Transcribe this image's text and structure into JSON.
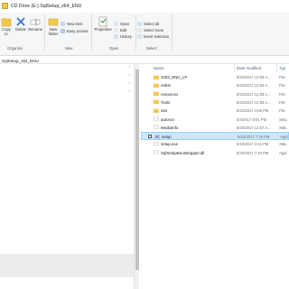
{
  "window": {
    "title": "CD Drive (E:) SqlSetup_x64_ENU"
  },
  "ribbon": {
    "copy_label": "Copy",
    "to_label": "to",
    "delete_label": "Delete",
    "rename_label": "Rename",
    "new_folder_label": "New",
    "new_folder_label2": "folder",
    "new_item_label": "New item",
    "easy_access_label": "Easy access",
    "properties_label": "Properties",
    "open_label": "Open",
    "edit_label": "Edit",
    "history_label": "History",
    "select_all_label": "Select all",
    "select_none_label": "Select none",
    "invert_selection_label": "Invert selection",
    "groups": {
      "organize": "Organize",
      "new": "New",
      "open": "Open",
      "select": "Select"
    }
  },
  "address": {
    "path": "SqlSetup_x64_ENU"
  },
  "columns": {
    "name": "Name",
    "date": "Date modified",
    "type": "Typ"
  },
  "files": [
    {
      "name": "1033_ENU_LP",
      "date": "8/22/2017 12:55 A...",
      "type": "File",
      "kind": "folder",
      "selected": false
    },
    {
      "name": "redist",
      "date": "8/22/2017 12:55 A...",
      "type": "File",
      "kind": "folder",
      "selected": false
    },
    {
      "name": "resources",
      "date": "8/22/2017 12:55 A...",
      "type": "File",
      "kind": "folder",
      "selected": false
    },
    {
      "name": "Tools",
      "date": "8/22/2017 12:55 A...",
      "type": "File",
      "kind": "folder",
      "selected": false
    },
    {
      "name": "x64",
      "date": "8/22/2017 4:55 PM",
      "type": "File",
      "kind": "folder",
      "selected": false
    },
    {
      "name": "autorun",
      "date": "6/4/2017 9:01 PM",
      "type": "Setu",
      "kind": "file",
      "selected": false
    },
    {
      "name": "MediaInfo",
      "date": "8/22/2017 12:57 A...",
      "type": "XML",
      "kind": "file",
      "selected": false
    },
    {
      "name": "setup",
      "date": "8/22/2017 7:39 PM",
      "type": "Appl",
      "kind": "app",
      "selected": true
    },
    {
      "name": "setup.exe",
      "date": "6/10/2017 3:41 PM",
      "type": "XML",
      "kind": "file",
      "selected": false
    },
    {
      "name": "SqlSetupBootstrapper.dll",
      "date": "8/22/2017 7:20 PM",
      "type": "Appl",
      "kind": "file",
      "selected": false
    }
  ],
  "colors": {
    "selection": "#cce8ff",
    "folder": "#f2c94c",
    "accent": "#0078d7"
  }
}
